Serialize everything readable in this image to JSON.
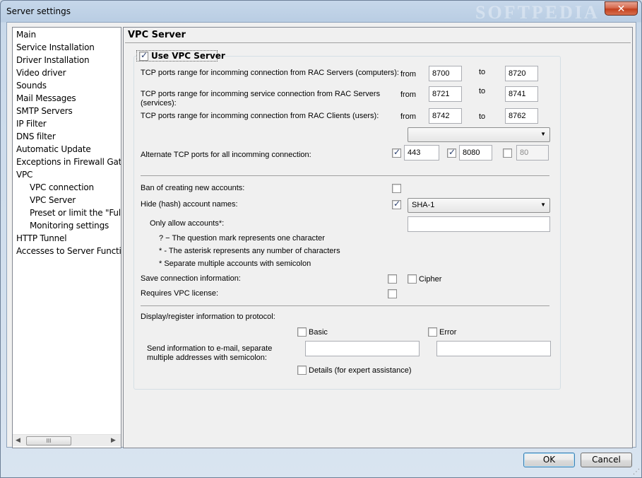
{
  "window": {
    "title": "Server settings",
    "close_glyph": "✕",
    "watermark": "SOFTPEDIA"
  },
  "tree": {
    "items": [
      {
        "label": "Main",
        "indent": 0
      },
      {
        "label": "Service Installation",
        "indent": 0
      },
      {
        "label": "Driver Installation",
        "indent": 0
      },
      {
        "label": "Video driver",
        "indent": 0
      },
      {
        "label": "Sounds",
        "indent": 0
      },
      {
        "label": "Mail Messages",
        "indent": 0
      },
      {
        "label": "SMTP Servers",
        "indent": 0
      },
      {
        "label": "IP Filter",
        "indent": 0
      },
      {
        "label": "DNS filter",
        "indent": 0
      },
      {
        "label": "Automatic Update",
        "indent": 0
      },
      {
        "label": "Exceptions in Firewall Gate c",
        "indent": 0
      },
      {
        "label": "VPC",
        "indent": 0
      },
      {
        "label": "VPC connection",
        "indent": 1
      },
      {
        "label": "VPC Server",
        "indent": 1
      },
      {
        "label": "Preset or limit the \"Full C",
        "indent": 1
      },
      {
        "label": "Monitoring settings",
        "indent": 1
      },
      {
        "label": "HTTP Tunnel",
        "indent": 0
      },
      {
        "label": "Accesses to Server Function",
        "indent": 0
      }
    ],
    "scroll_left": "◀",
    "scroll_right": "▶",
    "thumb_grip": "III"
  },
  "panel": {
    "title": "VPC Server",
    "use_vpc": {
      "label": "Use VPC Server",
      "checked": true
    },
    "ports": {
      "from_label": "from",
      "to_label": "to",
      "rows": [
        {
          "label": "TCP ports range for incomming connection from RAC Servers (computers):",
          "from": "8700",
          "to": "8720"
        },
        {
          "label": "TCP ports range for incomming service connection from RAC Servers (services):",
          "from": "8721",
          "to": "8741"
        },
        {
          "label": "TCP ports range for incomming connection from RAC Clients (users):",
          "from": "8742",
          "to": "8762"
        }
      ]
    },
    "ip_combo": {
      "value": "",
      "arrow": "▼"
    },
    "alternate": {
      "label": "Alternate TCP ports for all incomming connection:",
      "port1": {
        "value": "443",
        "checked": true
      },
      "port2": {
        "value": "8080",
        "checked": true
      },
      "port3": {
        "value": "80",
        "checked": false
      }
    },
    "ban": {
      "label": "Ban of creating new accounts:",
      "checked": false
    },
    "hide": {
      "label": "Hide (hash) account names:",
      "checked": true,
      "algorithm": "SHA-1"
    },
    "only_allow": {
      "label": "Only allow accounts*:",
      "value": "",
      "hints": [
        "? − The question mark represents one character",
        "* - The asterisk represents any number of characters",
        "* Separate multiple accounts with semicolon"
      ]
    },
    "save_conn": {
      "label": "Save connection information:",
      "checked": false,
      "cipher_label": "Cipher",
      "cipher_checked": false
    },
    "requires_license": {
      "label": "Requires VPC license:",
      "checked": false
    },
    "protocol": {
      "label": "Display/register information to protocol:",
      "basic_label": "Basic",
      "basic_checked": false,
      "error_label": "Error",
      "error_checked": false,
      "email_label_1": "Send information to e-mail, separate",
      "email_label_2": "multiple addresses with semicolon:",
      "email_basic": "",
      "email_error": "",
      "details_label": "Details (for expert assistance)",
      "details_checked": false
    }
  },
  "buttons": {
    "ok": "OK",
    "cancel": "Cancel"
  },
  "colors": {
    "accent": "#3c7fb1",
    "close": "#c3401f"
  }
}
